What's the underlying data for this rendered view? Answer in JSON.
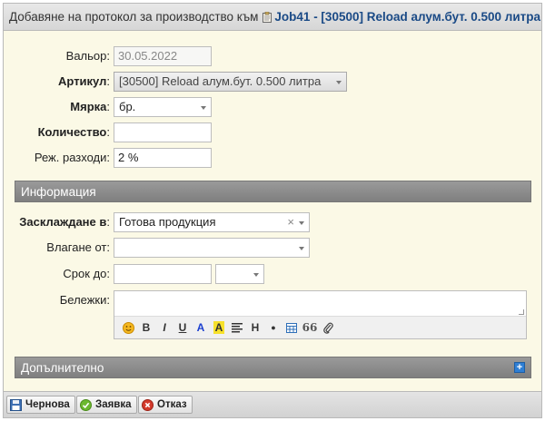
{
  "window": {
    "title_prefix": "Добавяне на протокол за производство към",
    "job_link": "Job41 - [30500] Reload алум.бут. 0.500 литра"
  },
  "fields": {
    "valor": {
      "label": "Вальор:",
      "value": "30.05.2022"
    },
    "article": {
      "label": "Артикул",
      "suffix": ":",
      "value": "[30500] Reload алум.бут. 0.500 литра"
    },
    "measure": {
      "label": "Мярка",
      "suffix": ":",
      "value": "бр."
    },
    "quantity": {
      "label": "Количество",
      "suffix": ":",
      "value": ""
    },
    "cutting_costs": {
      "label": "Реж. разходи:",
      "value": "2 %"
    }
  },
  "section_info": {
    "title": "Информация"
  },
  "info_fields": {
    "store_in": {
      "label": "Засклаждане в",
      "suffix": ":",
      "value": "Готова продукция",
      "clear": "×"
    },
    "input_from": {
      "label": "Влагане от:",
      "value": ""
    },
    "deadline": {
      "label": "Срок до:",
      "date": "",
      "time": ""
    },
    "notes": {
      "label": "Бележки:",
      "value": ""
    }
  },
  "editor_toolbar": {
    "bold": "B",
    "italic": "I",
    "underline": "U",
    "text_color": "A",
    "highlight": "A",
    "heading": "H",
    "bullet": "●",
    "quote": "66"
  },
  "section_more": {
    "title": "Допълнително",
    "toggle": "+"
  },
  "footer": {
    "draft_label": "Чернова",
    "request_label": "Заявка",
    "cancel_label": "Отказ"
  },
  "colors": {
    "panel_bg": "#fbf9e6",
    "link": "#1a4a86",
    "section_bar": "#8a8a8a"
  }
}
